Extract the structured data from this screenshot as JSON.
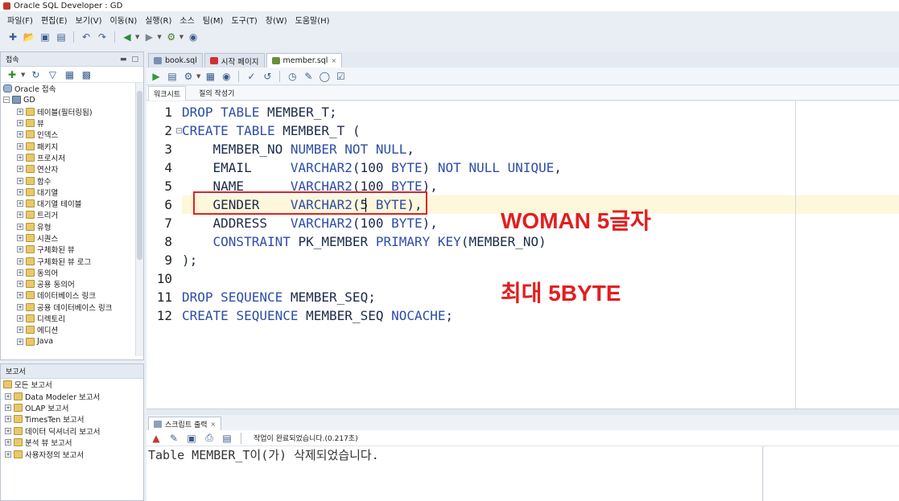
{
  "window": {
    "title": "Oracle SQL Developer : GD"
  },
  "menubar": {
    "items": [
      "파일(F)",
      "편집(E)",
      "보기(V)",
      "이동(N)",
      "실행(R)",
      "소스",
      "팀(M)",
      "도구(T)",
      "창(W)",
      "도움말(H)"
    ]
  },
  "connections_panel": {
    "title": "접속",
    "tree": [
      {
        "label": "Oracle 접속",
        "level": 0,
        "expanded": true
      },
      {
        "label": "GD",
        "level": 1,
        "expanded": true
      },
      {
        "label": "테이블(필터링됨)",
        "level": 2
      },
      {
        "label": "뷰",
        "level": 2
      },
      {
        "label": "인덱스",
        "level": 2
      },
      {
        "label": "패키지",
        "level": 2
      },
      {
        "label": "프로시저",
        "level": 2
      },
      {
        "label": "연산자",
        "level": 2
      },
      {
        "label": "함수",
        "level": 2
      },
      {
        "label": "대기열",
        "level": 2
      },
      {
        "label": "대기열 테이블",
        "level": 2
      },
      {
        "label": "트리거",
        "level": 2
      },
      {
        "label": "유형",
        "level": 2
      },
      {
        "label": "시퀀스",
        "level": 2
      },
      {
        "label": "구체화된 뷰",
        "level": 2
      },
      {
        "label": "구체화된 뷰 로그",
        "level": 2
      },
      {
        "label": "동의어",
        "level": 2
      },
      {
        "label": "공용 동의어",
        "level": 2
      },
      {
        "label": "데이터베이스 링크",
        "level": 2
      },
      {
        "label": "공용 데이터베이스 링크",
        "level": 2
      },
      {
        "label": "디렉토리",
        "level": 2
      },
      {
        "label": "에디션",
        "level": 2
      },
      {
        "label": "Java",
        "level": 2
      }
    ]
  },
  "reports_panel": {
    "title": "보고서",
    "tree": [
      {
        "label": "모든 보고서",
        "level": 0
      },
      {
        "label": "Data Modeler 보고서",
        "level": 1
      },
      {
        "label": "OLAP 보고서",
        "level": 1
      },
      {
        "label": "TimesTen 보고서",
        "level": 1
      },
      {
        "label": "데이터 딕셔너리 보고서",
        "level": 1
      },
      {
        "label": "분석 뷰 보고서",
        "level": 1
      },
      {
        "label": "사용자정의 보고서",
        "level": 1
      }
    ]
  },
  "doc_tabs": [
    {
      "label": "book.sql",
      "active": false,
      "icon_color": "#7a8fb0"
    },
    {
      "label": "시작 페이지",
      "active": false,
      "icon_color": "#d23030"
    },
    {
      "label": "member.sql",
      "active": true,
      "icon_color": "#6b8e3a"
    }
  ],
  "sub_tabs": {
    "worksheet": "워크시트",
    "query_builder": "질의 작성기"
  },
  "editor": {
    "line_numbers": [
      "1",
      "2",
      "3",
      "4",
      "5",
      "6",
      "7",
      "8",
      "9",
      "10",
      "11",
      "12"
    ],
    "lines": [
      "DROP TABLE MEMBER_T;",
      "CREATE TABLE MEMBER_T (",
      "    MEMBER_NO NUMBER NOT NULL,",
      "    EMAIL     VARCHAR2(100 BYTE) NOT NULL UNIQUE,",
      "    NAME      VARCHAR2(100 BYTE),",
      "    GENDER    VARCHAR2(5 BYTE),",
      "    ADDRESS   VARCHAR2(100 BYTE),",
      "    CONSTRAINT PK_MEMBER PRIMARY KEY(MEMBER_NO)",
      ");",
      "",
      "DROP SEQUENCE MEMBER_SEQ;",
      "CREATE SEQUENCE MEMBER_SEQ NOCACHE;"
    ]
  },
  "annotations": {
    "note1": "WOMAN 5글자",
    "note2": "최대 5BYTE",
    "highlight_color": "#e02222"
  },
  "output": {
    "tab_label": "스크립트 출력",
    "status": "작업이 완료되었습니다.(0.217초)",
    "text": "Table MEMBER_T이(가) 삭제되었습니다."
  }
}
